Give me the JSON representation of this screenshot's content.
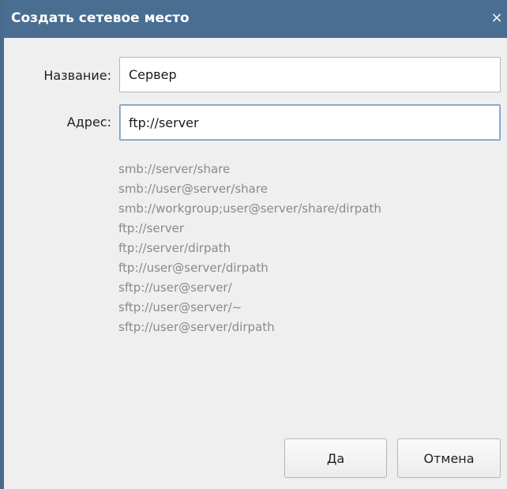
{
  "dialog": {
    "title": "Создать сетевое место",
    "close_glyph": "×",
    "close_icon": "close-icon"
  },
  "form": {
    "name_label": "Название:",
    "name_value": "Сервер",
    "address_label": "Адрес:",
    "address_value": "ftp://server"
  },
  "examples": [
    "smb://server/share",
    "smb://user@server/share",
    "smb://workgroup;user@server/share/dirpath",
    "ftp://server",
    "ftp://server/dirpath",
    "ftp://user@server/dirpath",
    "sftp://user@server/",
    "sftp://user@server/~",
    "sftp://user@server/dirpath"
  ],
  "buttons": {
    "ok_label": "Да",
    "cancel_label": "Отмена"
  },
  "colors": {
    "titlebar": "#4a6e92",
    "focus_border": "#7a9bc4",
    "hint_text": "#8a8a8a"
  }
}
